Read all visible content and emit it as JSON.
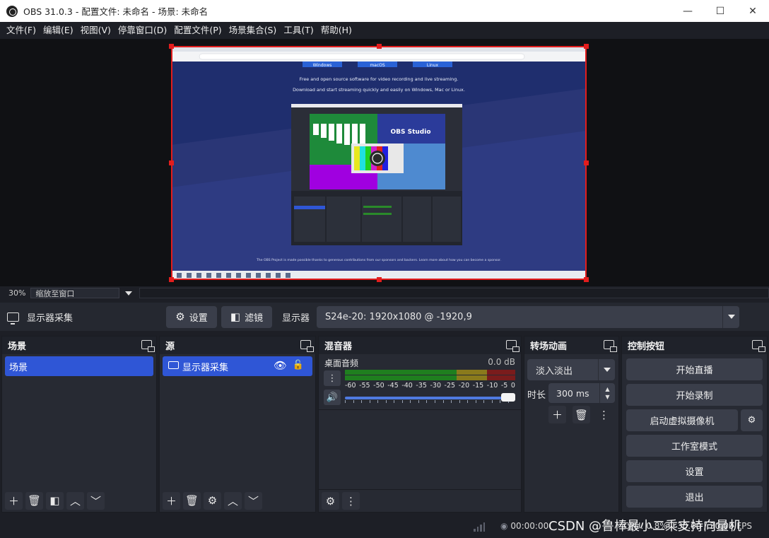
{
  "window": {
    "title": "OBS 31.0.3 - 配置文件: 未命名 - 场景: 未命名",
    "minimize": "—",
    "maximize": "☐",
    "close": "✕"
  },
  "menu": [
    "文件(F)",
    "编辑(E)",
    "视图(V)",
    "停靠窗口(D)",
    "配置文件(P)",
    "场景集合(S)",
    "工具(T)",
    "帮助(H)"
  ],
  "preview": {
    "zoom": "30%",
    "zoom_mode": "缩放至窗口",
    "screen_texts": {
      "line1": "Free and open source software for video recording and live streaming.",
      "line2": "Download and start streaming quickly and easily on Windows, Mac or Linux.",
      "inner_title": "OBS Studio",
      "footer": "The OBS Project is made possible thanks to generous contributions from our sponsors and backers. Learn more about how you can become a sponsor.",
      "btn_windows": "Windows",
      "btn_mac": "macOS",
      "btn_linux": "Linux"
    }
  },
  "context": {
    "source_name": "显示器采集",
    "settings": "设置",
    "filters": "滤镜",
    "display_label": "显示器",
    "display_value": "S24e-20: 1920x1080 @ -1920,9"
  },
  "docks": {
    "scenes": {
      "title": "场景",
      "items": [
        "场景"
      ]
    },
    "sources": {
      "title": "源",
      "items": [
        "显示器采集"
      ]
    },
    "mixer": {
      "title": "混音器",
      "channel": "桌面音频",
      "level": "0.0 dB",
      "scale": [
        "-60",
        "-55",
        "-50",
        "-45",
        "-40",
        "-35",
        "-30",
        "-25",
        "-20",
        "-15",
        "-10",
        "-5",
        "0"
      ],
      "volume_percent": 100
    },
    "transitions": {
      "title": "转场动画",
      "selected": "淡入淡出",
      "duration_label": "时长",
      "duration": "300 ms"
    },
    "controls": {
      "title": "控制按钮",
      "start_stream": "开始直播",
      "start_record": "开始录制",
      "virtual_cam": "启动虚拟摄像机",
      "studio_mode": "工作室模式",
      "settings": "设置",
      "exit": "退出"
    }
  },
  "status": {
    "time": "00:00:00",
    "cpu": "CPU: 0.8%",
    "fps": "30.00 / 30.00 FPS",
    "watermark": "CSDN @鲁棒最小二乘支持向量机"
  },
  "colors": {
    "selection": "#e31d1d",
    "accent": "#2f56d6",
    "meter_green": "#1f7f1f",
    "meter_yellow": "#8a7a1c",
    "meter_red": "#7a1c1c"
  }
}
